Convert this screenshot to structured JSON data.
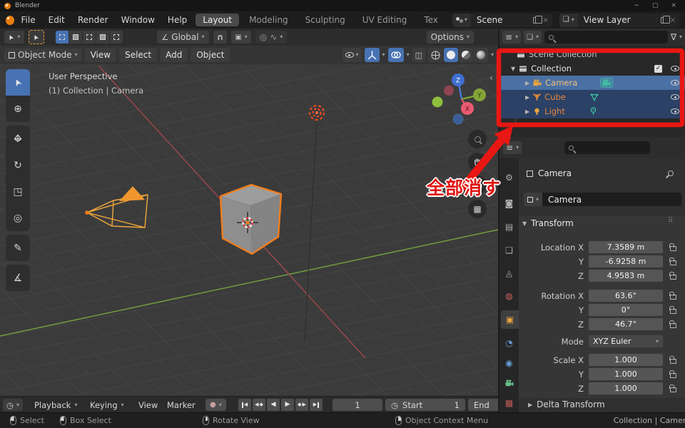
{
  "window": {
    "title": "Blender"
  },
  "topbar": {
    "menus": [
      "File",
      "Edit",
      "Render",
      "Window",
      "Help"
    ],
    "workspaces": [
      {
        "label": "Layout",
        "active": true
      },
      {
        "label": "Modeling",
        "active": false
      },
      {
        "label": "Sculpting",
        "active": false
      },
      {
        "label": "UV Editing",
        "active": false
      },
      {
        "label": "Tex",
        "active": false
      }
    ],
    "scene": {
      "label": "Scene"
    },
    "view_layer": {
      "label": "View Layer"
    }
  },
  "tool_settings": {
    "orientation": "Global",
    "options": "Options"
  },
  "viewport_header": {
    "mode": "Object Mode",
    "menus": [
      "View",
      "Select",
      "Add",
      "Object"
    ]
  },
  "viewport": {
    "overlay1": "User Perspective",
    "overlay2": "(1) Collection | Camera",
    "gizmo": {
      "x": "X",
      "y": "Y",
      "z": "Z"
    }
  },
  "outliner": {
    "scene_collection": "Scene Collection",
    "collection": "Collection",
    "camera": "Camera",
    "cube": "Cube",
    "light": "Light"
  },
  "annotation": {
    "text": "全部消す"
  },
  "properties": {
    "breadcrumb": "Camera",
    "object_name": "Camera",
    "transform_label": "Transform",
    "transform_rows": [
      {
        "label": "Location X",
        "value": "7.3589 m"
      },
      {
        "label": "Y",
        "value": "-6.9258 m"
      },
      {
        "label": "Z",
        "value": "4.9583 m"
      },
      {
        "label": "Rotation X",
        "value": "63.6°"
      },
      {
        "label": "Y",
        "value": "0°"
      },
      {
        "label": "Z",
        "value": "46.7°"
      }
    ],
    "mode": {
      "label": "Mode",
      "value": "XYZ Euler"
    },
    "scale_rows": [
      {
        "label": "Scale X",
        "value": "1.000"
      },
      {
        "label": "Y",
        "value": "1.000"
      },
      {
        "label": "Z",
        "value": "1.000"
      }
    ],
    "delta_label": "Delta Transform"
  },
  "timeline": {
    "menus": [
      "Playback",
      "Keying",
      "View",
      "Marker"
    ],
    "current_frame": "1",
    "start_label": "Start",
    "start_value": "1",
    "end_label": "End"
  },
  "statusbar": {
    "items": [
      "Select",
      "Box Select",
      "Rotate View",
      "Object Context Menu"
    ],
    "context": "Collection | Camera"
  },
  "colors": {
    "accent_blue": "#4772b3",
    "object_orange": "#e8a33d",
    "selection_outline": "#f07f1e",
    "row_active": "#4a70a4",
    "row_selected": "#2b4165",
    "annotation_red": "#e81713",
    "data_teal": "#41c0a2"
  },
  "icons": {
    "chevron_down": "▾",
    "disclosure_open": "▼",
    "disclosure_closed": "▶",
    "close": "×",
    "funnel": "∇",
    "menu": "≡",
    "layers": "❏",
    "check": "✓",
    "grip": "⠿",
    "minimize": "−",
    "maximize": "▢",
    "tri_left": "◀",
    "tri_right": "▶",
    "diamond": "◆",
    "clock": "◷",
    "record": "●",
    "magnet": "∩",
    "axis_angle": "∠",
    "falloff_wave": "∿",
    "prop_circle": "◎",
    "grid": "▦",
    "pointer": "➤",
    "crosshair": "⊕",
    "rotate": "↻",
    "scale": "◳",
    "annotate": "✎",
    "measure": "∡",
    "gear": "⚙",
    "camera_back": "◙",
    "printer": "▤",
    "scene_cone": "◬",
    "world": "◍",
    "obj_square": "▣",
    "constraint": "◔",
    "physics": "◉",
    "texture": "▩",
    "collapse": "‹",
    "arrow_h": "↔",
    "arrow_v": "↕",
    "xray": "◫",
    "snap_target": "▣"
  }
}
